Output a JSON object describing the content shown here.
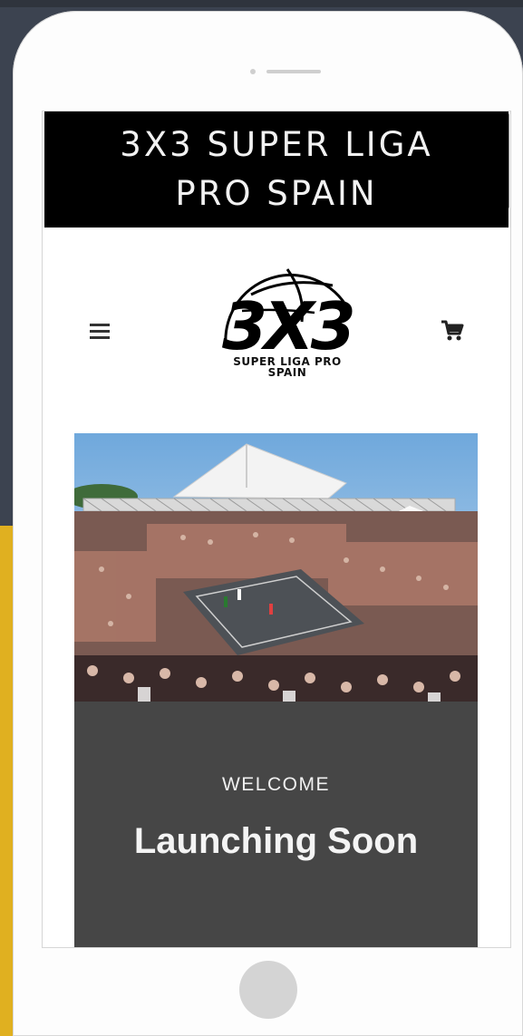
{
  "site": {
    "banner_line1": "3X3 SUPER LIGA",
    "banner_line2": "PRO SPAIN"
  },
  "logo": {
    "mark": "3X3",
    "subtitle_line1": "SUPER LIGA PRO",
    "subtitle_line2": "SPAIN"
  },
  "header": {
    "menu_icon": "hamburger-menu-icon",
    "cart_icon": "shopping-cart-icon"
  },
  "hero": {
    "eyebrow": "WELCOME",
    "headline": "Launching Soon",
    "overlay_color": "#464646"
  },
  "colors": {
    "background": "#3c4350",
    "accent": "#e0b020",
    "device": "#fdfdfd"
  }
}
